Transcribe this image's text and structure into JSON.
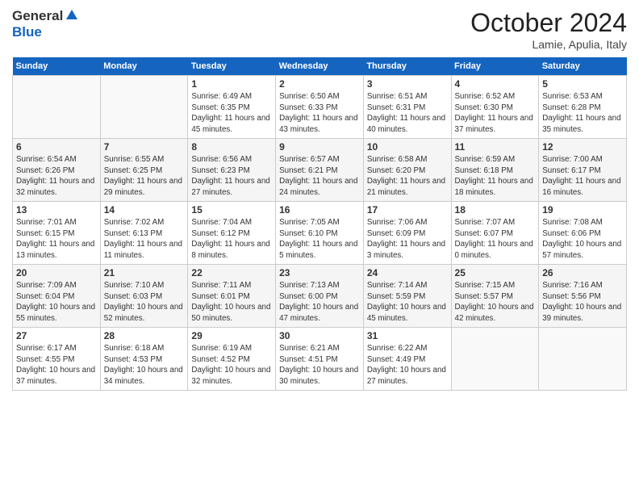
{
  "logo": {
    "general": "General",
    "blue": "Blue"
  },
  "header": {
    "month": "October 2024",
    "location": "Lamie, Apulia, Italy"
  },
  "days_of_week": [
    "Sunday",
    "Monday",
    "Tuesday",
    "Wednesday",
    "Thursday",
    "Friday",
    "Saturday"
  ],
  "weeks": [
    [
      {
        "day": "",
        "info": ""
      },
      {
        "day": "",
        "info": ""
      },
      {
        "day": "1",
        "info": "Sunrise: 6:49 AM\nSunset: 6:35 PM\nDaylight: 11 hours and 45 minutes."
      },
      {
        "day": "2",
        "info": "Sunrise: 6:50 AM\nSunset: 6:33 PM\nDaylight: 11 hours and 43 minutes."
      },
      {
        "day": "3",
        "info": "Sunrise: 6:51 AM\nSunset: 6:31 PM\nDaylight: 11 hours and 40 minutes."
      },
      {
        "day": "4",
        "info": "Sunrise: 6:52 AM\nSunset: 6:30 PM\nDaylight: 11 hours and 37 minutes."
      },
      {
        "day": "5",
        "info": "Sunrise: 6:53 AM\nSunset: 6:28 PM\nDaylight: 11 hours and 35 minutes."
      }
    ],
    [
      {
        "day": "6",
        "info": "Sunrise: 6:54 AM\nSunset: 6:26 PM\nDaylight: 11 hours and 32 minutes."
      },
      {
        "day": "7",
        "info": "Sunrise: 6:55 AM\nSunset: 6:25 PM\nDaylight: 11 hours and 29 minutes."
      },
      {
        "day": "8",
        "info": "Sunrise: 6:56 AM\nSunset: 6:23 PM\nDaylight: 11 hours and 27 minutes."
      },
      {
        "day": "9",
        "info": "Sunrise: 6:57 AM\nSunset: 6:21 PM\nDaylight: 11 hours and 24 minutes."
      },
      {
        "day": "10",
        "info": "Sunrise: 6:58 AM\nSunset: 6:20 PM\nDaylight: 11 hours and 21 minutes."
      },
      {
        "day": "11",
        "info": "Sunrise: 6:59 AM\nSunset: 6:18 PM\nDaylight: 11 hours and 18 minutes."
      },
      {
        "day": "12",
        "info": "Sunrise: 7:00 AM\nSunset: 6:17 PM\nDaylight: 11 hours and 16 minutes."
      }
    ],
    [
      {
        "day": "13",
        "info": "Sunrise: 7:01 AM\nSunset: 6:15 PM\nDaylight: 11 hours and 13 minutes."
      },
      {
        "day": "14",
        "info": "Sunrise: 7:02 AM\nSunset: 6:13 PM\nDaylight: 11 hours and 11 minutes."
      },
      {
        "day": "15",
        "info": "Sunrise: 7:04 AM\nSunset: 6:12 PM\nDaylight: 11 hours and 8 minutes."
      },
      {
        "day": "16",
        "info": "Sunrise: 7:05 AM\nSunset: 6:10 PM\nDaylight: 11 hours and 5 minutes."
      },
      {
        "day": "17",
        "info": "Sunrise: 7:06 AM\nSunset: 6:09 PM\nDaylight: 11 hours and 3 minutes."
      },
      {
        "day": "18",
        "info": "Sunrise: 7:07 AM\nSunset: 6:07 PM\nDaylight: 11 hours and 0 minutes."
      },
      {
        "day": "19",
        "info": "Sunrise: 7:08 AM\nSunset: 6:06 PM\nDaylight: 10 hours and 57 minutes."
      }
    ],
    [
      {
        "day": "20",
        "info": "Sunrise: 7:09 AM\nSunset: 6:04 PM\nDaylight: 10 hours and 55 minutes."
      },
      {
        "day": "21",
        "info": "Sunrise: 7:10 AM\nSunset: 6:03 PM\nDaylight: 10 hours and 52 minutes."
      },
      {
        "day": "22",
        "info": "Sunrise: 7:11 AM\nSunset: 6:01 PM\nDaylight: 10 hours and 50 minutes."
      },
      {
        "day": "23",
        "info": "Sunrise: 7:13 AM\nSunset: 6:00 PM\nDaylight: 10 hours and 47 minutes."
      },
      {
        "day": "24",
        "info": "Sunrise: 7:14 AM\nSunset: 5:59 PM\nDaylight: 10 hours and 45 minutes."
      },
      {
        "day": "25",
        "info": "Sunrise: 7:15 AM\nSunset: 5:57 PM\nDaylight: 10 hours and 42 minutes."
      },
      {
        "day": "26",
        "info": "Sunrise: 7:16 AM\nSunset: 5:56 PM\nDaylight: 10 hours and 39 minutes."
      }
    ],
    [
      {
        "day": "27",
        "info": "Sunrise: 6:17 AM\nSunset: 4:55 PM\nDaylight: 10 hours and 37 minutes."
      },
      {
        "day": "28",
        "info": "Sunrise: 6:18 AM\nSunset: 4:53 PM\nDaylight: 10 hours and 34 minutes."
      },
      {
        "day": "29",
        "info": "Sunrise: 6:19 AM\nSunset: 4:52 PM\nDaylight: 10 hours and 32 minutes."
      },
      {
        "day": "30",
        "info": "Sunrise: 6:21 AM\nSunset: 4:51 PM\nDaylight: 10 hours and 30 minutes."
      },
      {
        "day": "31",
        "info": "Sunrise: 6:22 AM\nSunset: 4:49 PM\nDaylight: 10 hours and 27 minutes."
      },
      {
        "day": "",
        "info": ""
      },
      {
        "day": "",
        "info": ""
      }
    ]
  ]
}
